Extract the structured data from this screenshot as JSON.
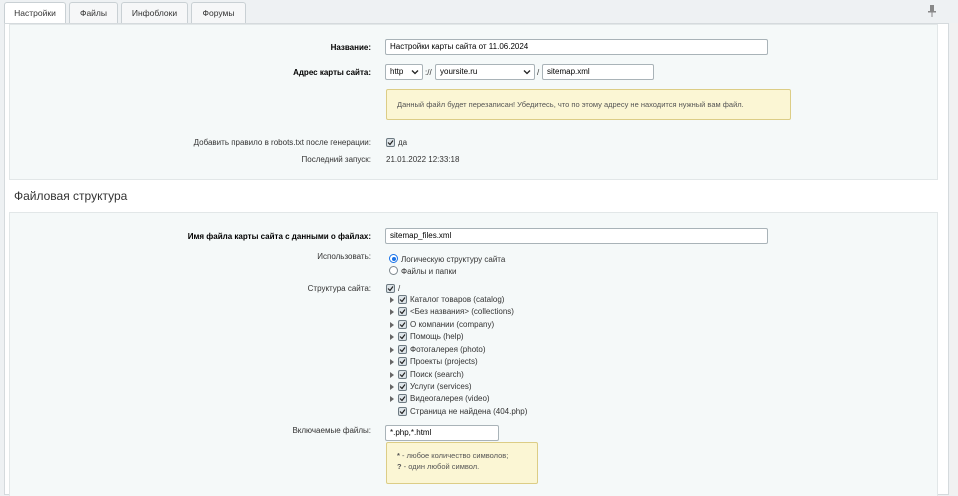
{
  "tabs": [
    "Настройки",
    "Файлы",
    "Инфоблоки",
    "Форумы"
  ],
  "main": {
    "name_label": "Название:",
    "name_value": "Настройки карты сайта от 11.06.2024",
    "address_label": "Адрес карты сайта:",
    "protocol": "http",
    "protocol_sep": "://",
    "domain": "yoursite.ru",
    "path_sep": "/",
    "filename": "sitemap.xml",
    "overwrite_warning": "Данный файл будет перезаписан! Убедитесь, что по этому адресу не находится нужный вам файл.",
    "robots_label": "Добавить правило в robots.txt после генерации:",
    "robots_value": "да",
    "last_run_label": "Последний запуск:",
    "last_run_value": "21.01.2022 12:33:18"
  },
  "files_section": {
    "title": "Файловая структура",
    "filename_label": "Имя файла карты сайта с данными о файлах:",
    "filename_value": "sitemap_files.xml",
    "use_label": "Использовать:",
    "use_options": [
      "Логическую структуру сайта",
      "Файлы и папки"
    ],
    "use_selected": 0,
    "structure_label": "Структура сайта:",
    "root": "/",
    "tree": [
      "Каталог товаров (catalog)",
      "<Без названия> (collections)",
      "О компании (company)",
      "Помощь (help)",
      "Фотогалерея (photo)",
      "Проекты (projects)",
      "Поиск (search)",
      "Услуги (services)",
      "Видеогалерея (video)",
      "Страница не найдена (404.php)"
    ],
    "include_label": "Включаемые файлы:",
    "include_value": "*.php,*.html",
    "hint_star": "*",
    "hint_star_text": " - любое количество символов;",
    "hint_q": "?",
    "hint_q_text": " - один любой символ."
  },
  "icons": {
    "pin": "pin-icon",
    "check": "check-icon",
    "expand": "triangle-right-icon",
    "dropdown": "chevron-down-icon"
  },
  "colors": {
    "accent": "#1a73e8",
    "note_bg": "#fbf6d4",
    "panel_bg": "#f5f9f9"
  }
}
